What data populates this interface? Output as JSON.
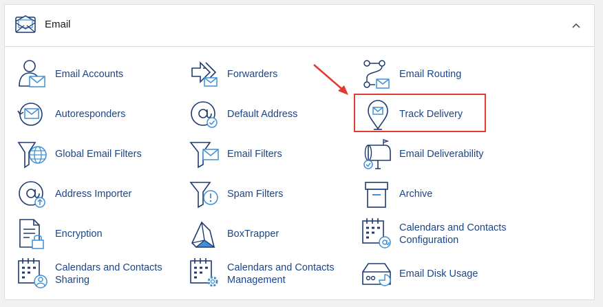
{
  "section": {
    "title": "Email",
    "icon": "envelope-open-icon",
    "expanded": true
  },
  "colors": {
    "link": "#1b4587",
    "icon_stroke": "#1e3a6f",
    "icon_accent": "#3d8fd6",
    "annotation": "#e03a33"
  },
  "items": [
    {
      "label": "Email Accounts",
      "icon": "user-envelope-icon"
    },
    {
      "label": "Forwarders",
      "icon": "forward-arrows-icon"
    },
    {
      "label": "Email Routing",
      "icon": "routing-nodes-icon"
    },
    {
      "label": "Autoresponders",
      "icon": "envelope-reply-icon"
    },
    {
      "label": "Default Address",
      "icon": "at-check-icon"
    },
    {
      "label": "Track Delivery",
      "icon": "location-pin-envelope-icon"
    },
    {
      "label": "Global Email Filters",
      "icon": "globe-funnel-icon"
    },
    {
      "label": "Email Filters",
      "icon": "funnel-envelope-icon"
    },
    {
      "label": "Email Deliverability",
      "icon": "mailbox-check-icon"
    },
    {
      "label": "Address Importer",
      "icon": "at-upload-icon"
    },
    {
      "label": "Spam Filters",
      "icon": "funnel-warning-icon"
    },
    {
      "label": "Archive",
      "icon": "archive-box-icon"
    },
    {
      "label": "Encryption",
      "icon": "document-lock-icon"
    },
    {
      "label": "BoxTrapper",
      "icon": "box-trap-icon"
    },
    {
      "label": "Calendars and Contacts Configuration",
      "icon": "calendar-at-icon"
    },
    {
      "label": "Calendars and Contacts Sharing",
      "icon": "calendar-user-icon"
    },
    {
      "label": "Calendars and Contacts Management",
      "icon": "calendar-gear-icon"
    },
    {
      "label": "Email Disk Usage",
      "icon": "disk-usage-icon"
    }
  ],
  "annotation": {
    "highlighted_item": "Track Delivery"
  }
}
